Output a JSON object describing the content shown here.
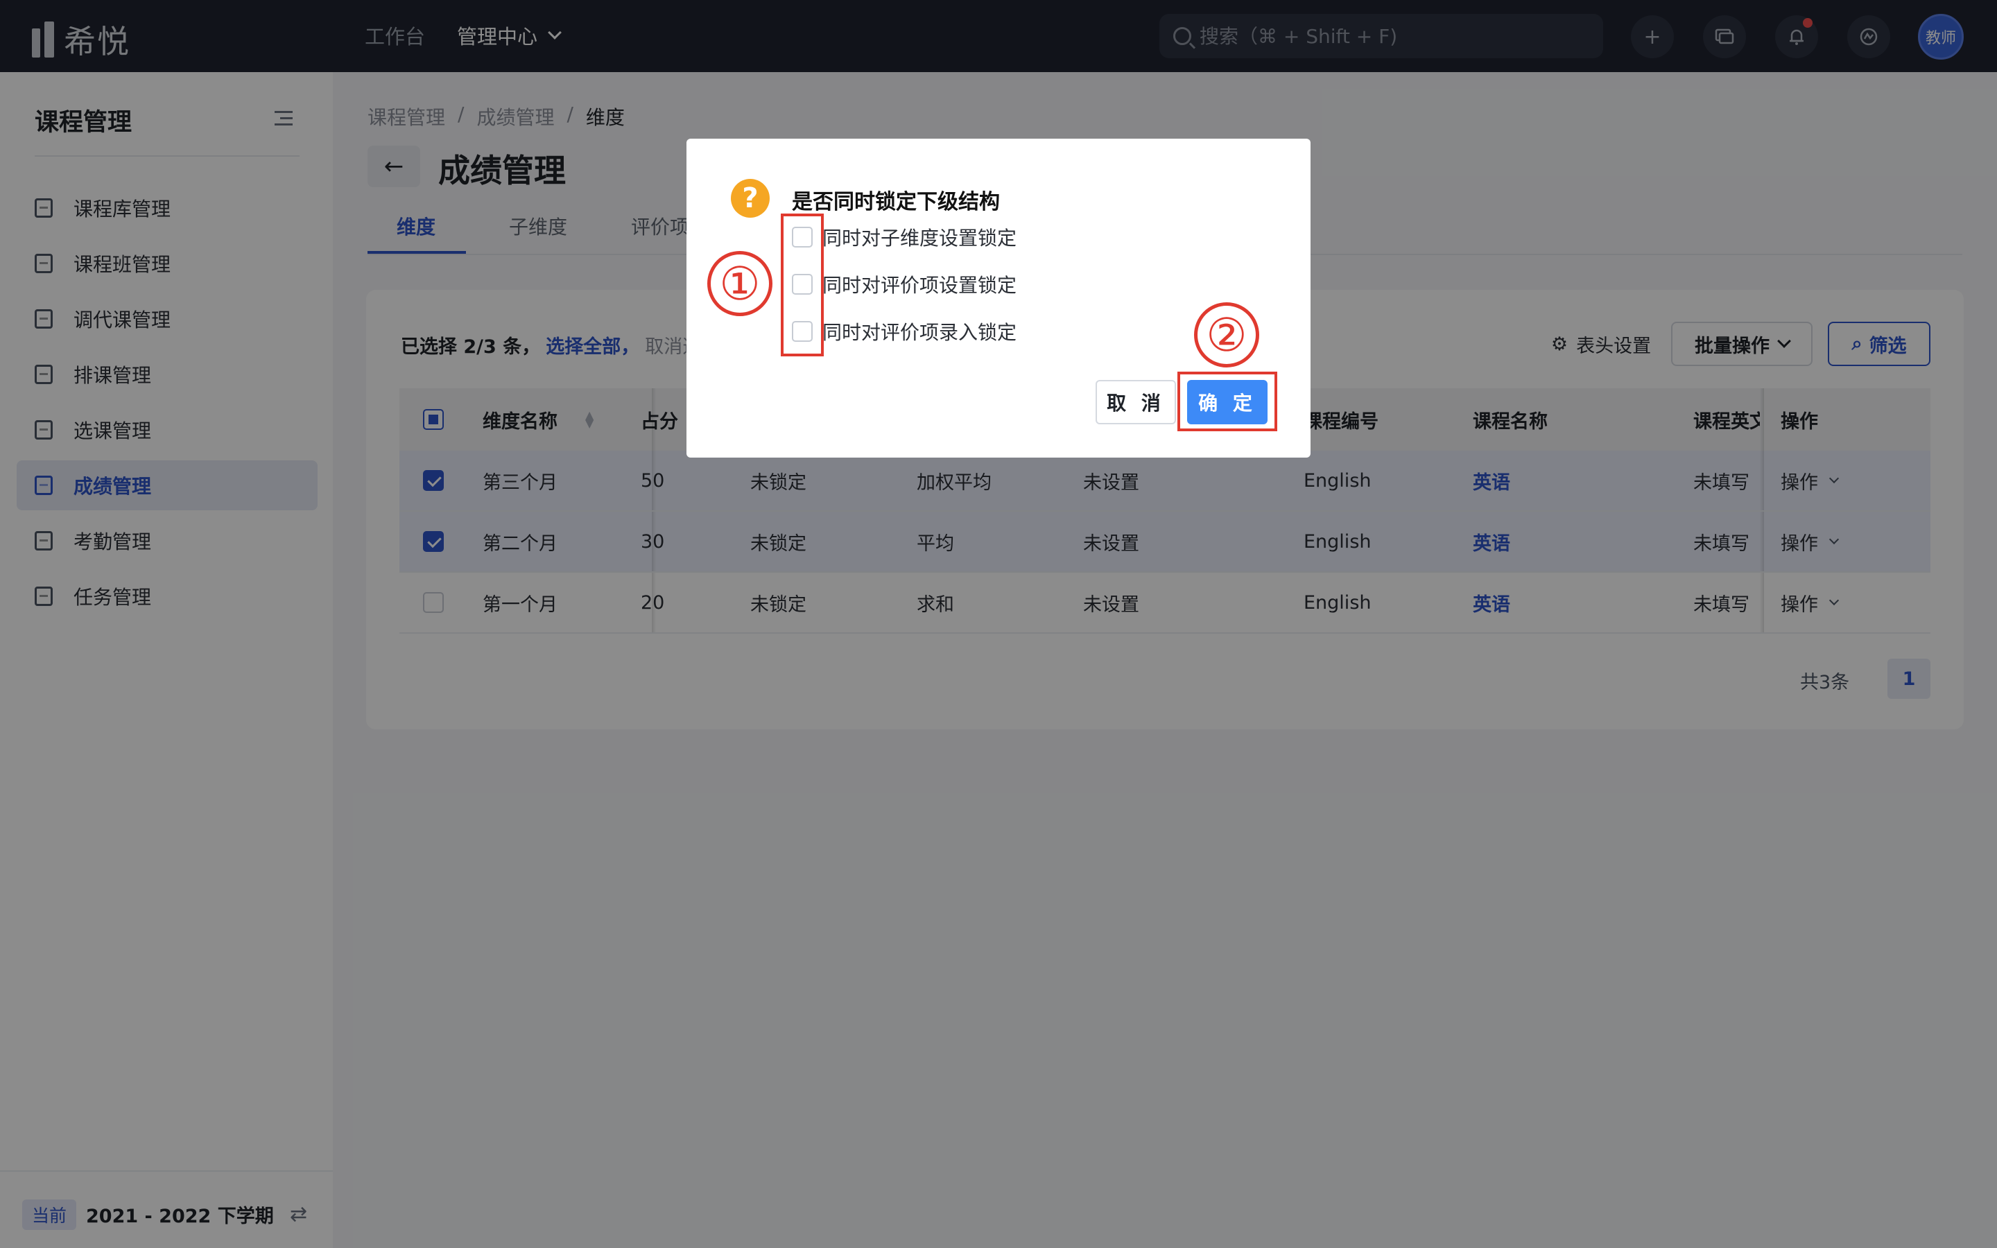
{
  "topbar": {
    "logo_text": "希悦",
    "nav": [
      {
        "label": "工作台"
      },
      {
        "label": "管理中心"
      }
    ],
    "search_placeholder": "搜索（⌘ + Shift + F)",
    "icons": [
      "plus-icon",
      "message-icon",
      "bell-icon",
      "activity-icon"
    ],
    "avatar_label": "教师",
    "notification_dot_color": "#f04e4e"
  },
  "sidebar": {
    "title": "课程管理",
    "items": [
      {
        "label": "课程库管理",
        "icon": "course-library-icon"
      },
      {
        "label": "课程班管理",
        "icon": "course-class-icon"
      },
      {
        "label": "调代课管理",
        "icon": "substitute-icon"
      },
      {
        "label": "排课管理",
        "icon": "schedule-icon"
      },
      {
        "label": "选课管理",
        "icon": "selection-icon"
      },
      {
        "label": "成绩管理",
        "icon": "grades-icon",
        "active": true
      },
      {
        "label": "考勤管理",
        "icon": "attendance-icon"
      },
      {
        "label": "任务管理",
        "icon": "task-icon"
      }
    ],
    "term_badge": "当前",
    "term_text": "2021 - 2022 下学期"
  },
  "main": {
    "breadcrumb": [
      "课程管理",
      "成绩管理",
      "维度"
    ],
    "breadcrumb_sep": "/",
    "title": "成绩管理",
    "tabs": [
      "维度",
      "子维度",
      "评价项"
    ],
    "selection": {
      "prefix": "已选择 2/3 条，",
      "select_all": "选择全部，",
      "cancel": "取消选"
    },
    "toolbar": {
      "header_settings": "表头设置",
      "batch": "批量操作",
      "filter": "筛选"
    },
    "table": {
      "headers": [
        "维度名称",
        "占分",
        "课程编号",
        "课程名称",
        "课程英文",
        "操作"
      ],
      "rows": [
        {
          "checked": true,
          "name": "第三个月",
          "score": "50",
          "lock": "未锁定",
          "method": "加权平均",
          "setting": "未设置",
          "code": "English",
          "course": "英语",
          "en": "未填写",
          "op": "操作"
        },
        {
          "checked": true,
          "name": "第二个月",
          "score": "30",
          "lock": "未锁定",
          "method": "平均",
          "setting": "未设置",
          "code": "English",
          "course": "英语",
          "en": "未填写",
          "op": "操作"
        },
        {
          "checked": false,
          "name": "第一个月",
          "score": "20",
          "lock": "未锁定",
          "method": "求和",
          "setting": "未设置",
          "code": "English",
          "course": "英语",
          "en": "未填写",
          "op": "操作"
        }
      ]
    },
    "pager": {
      "total": "共3条",
      "page": "1"
    }
  },
  "modal": {
    "title": "是否同时锁定下级结构",
    "options": [
      {
        "label": "同时对子维度设置锁定",
        "checked": false
      },
      {
        "label": "同时对评价项设置锁定",
        "checked": false
      },
      {
        "label": "同时对评价项录入锁定",
        "checked": false
      }
    ],
    "cancel": "取 消",
    "ok": "确 定"
  },
  "annotations": {
    "step1": "①",
    "step2": "②",
    "color": "#e03a2f"
  },
  "colors": {
    "primary": "#2f54c8",
    "ok_button": "#3d8af7",
    "warning": "#f5a623",
    "topbar": "#1f2430"
  }
}
